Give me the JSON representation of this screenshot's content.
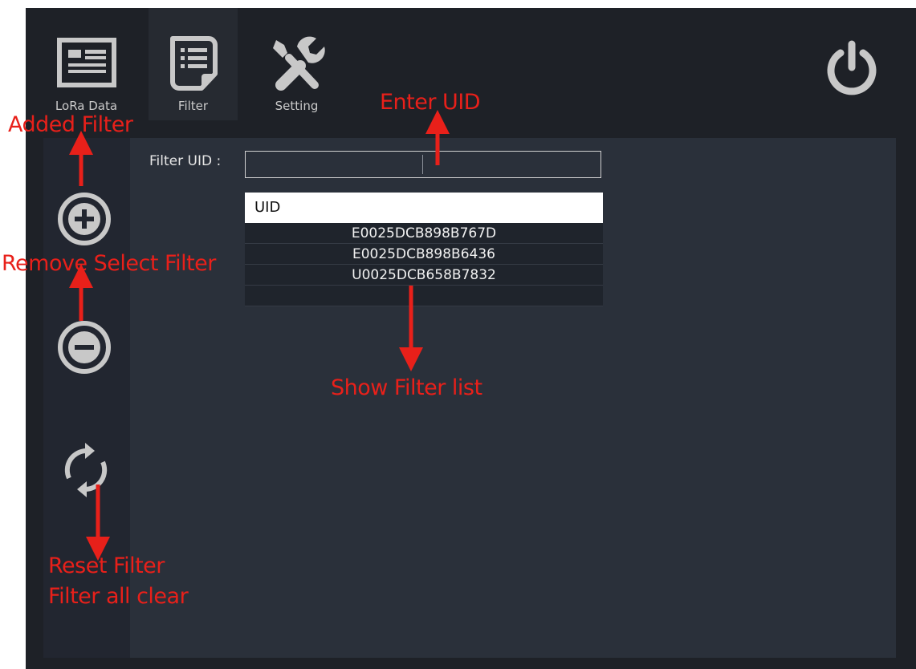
{
  "tabs": [
    {
      "label": "LoRa Data",
      "icon": "news-icon"
    },
    {
      "label": "Filter",
      "icon": "document-list-icon"
    },
    {
      "label": "Setting",
      "icon": "tools-icon"
    }
  ],
  "filter": {
    "label": "Filter UID :",
    "input_value": "",
    "table_header": "UID",
    "rows": [
      "E0025DCB898B767D",
      "E0025DCB898B6436",
      "U0025DCB658B7832",
      ""
    ]
  },
  "annotations": {
    "added_filter": "Added Filter",
    "remove_filter": "Remove Select Filter",
    "enter_uid": "Enter UID",
    "show_list": "Show Filter list",
    "reset_filter": "Reset Filter",
    "filter_clear": "Filter all clear"
  },
  "colors": {
    "annotation": "#e8201a",
    "icon": "#c8c8c8",
    "background": "#1e2127",
    "panel": "#2a303a"
  }
}
